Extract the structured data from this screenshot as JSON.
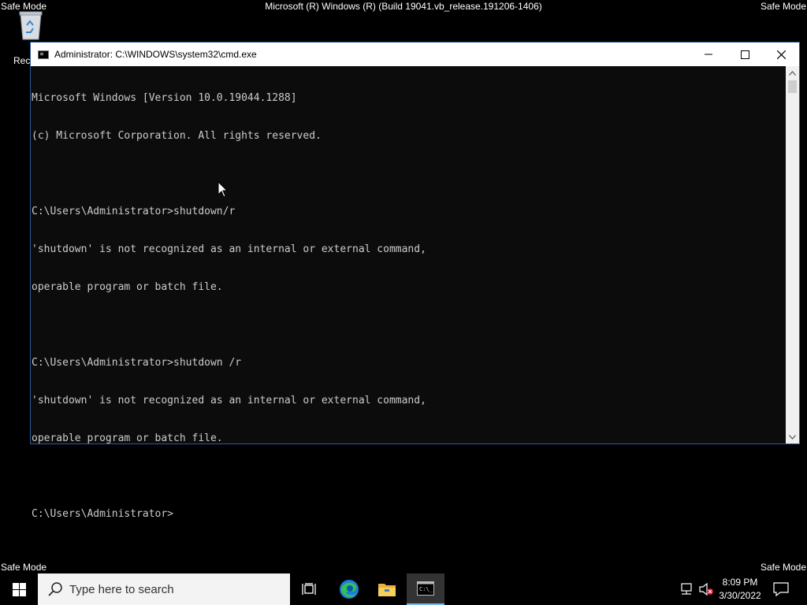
{
  "desktop": {
    "safe_mode_label": "Safe Mode",
    "build_info": "Microsoft (R) Windows (R) (Build 19041.vb_release.191206-1406)",
    "recycle_bin_label": "Recyc"
  },
  "cmd_window": {
    "title": "Administrator: C:\\WINDOWS\\system32\\cmd.exe",
    "lines": [
      "Microsoft Windows [Version 10.0.19044.1288]",
      "(c) Microsoft Corporation. All rights reserved.",
      "",
      "C:\\Users\\Administrator>shutdown/r",
      "'shutdown' is not recognized as an internal or external command,",
      "operable program or batch file.",
      "",
      "C:\\Users\\Administrator>shutdown /r",
      "'shutdown' is not recognized as an internal or external command,",
      "operable program or batch file.",
      "",
      "C:\\Users\\Administrator>"
    ]
  },
  "taskbar": {
    "search_placeholder": "Type here to search",
    "time": "8:09 PM",
    "date": "3/30/2022",
    "icons": [
      "windows-start-icon",
      "search-icon",
      "task-view-icon",
      "edge-icon",
      "file-explorer-icon",
      "cmd-icon",
      "network-icon",
      "volume-muted-icon",
      "notification-icon"
    ]
  },
  "colors": {
    "console_bg": "#0c0c0c",
    "console_text": "#cccccc",
    "taskbar_bg": "#000000",
    "active_task_accent": "#76b9ed"
  }
}
